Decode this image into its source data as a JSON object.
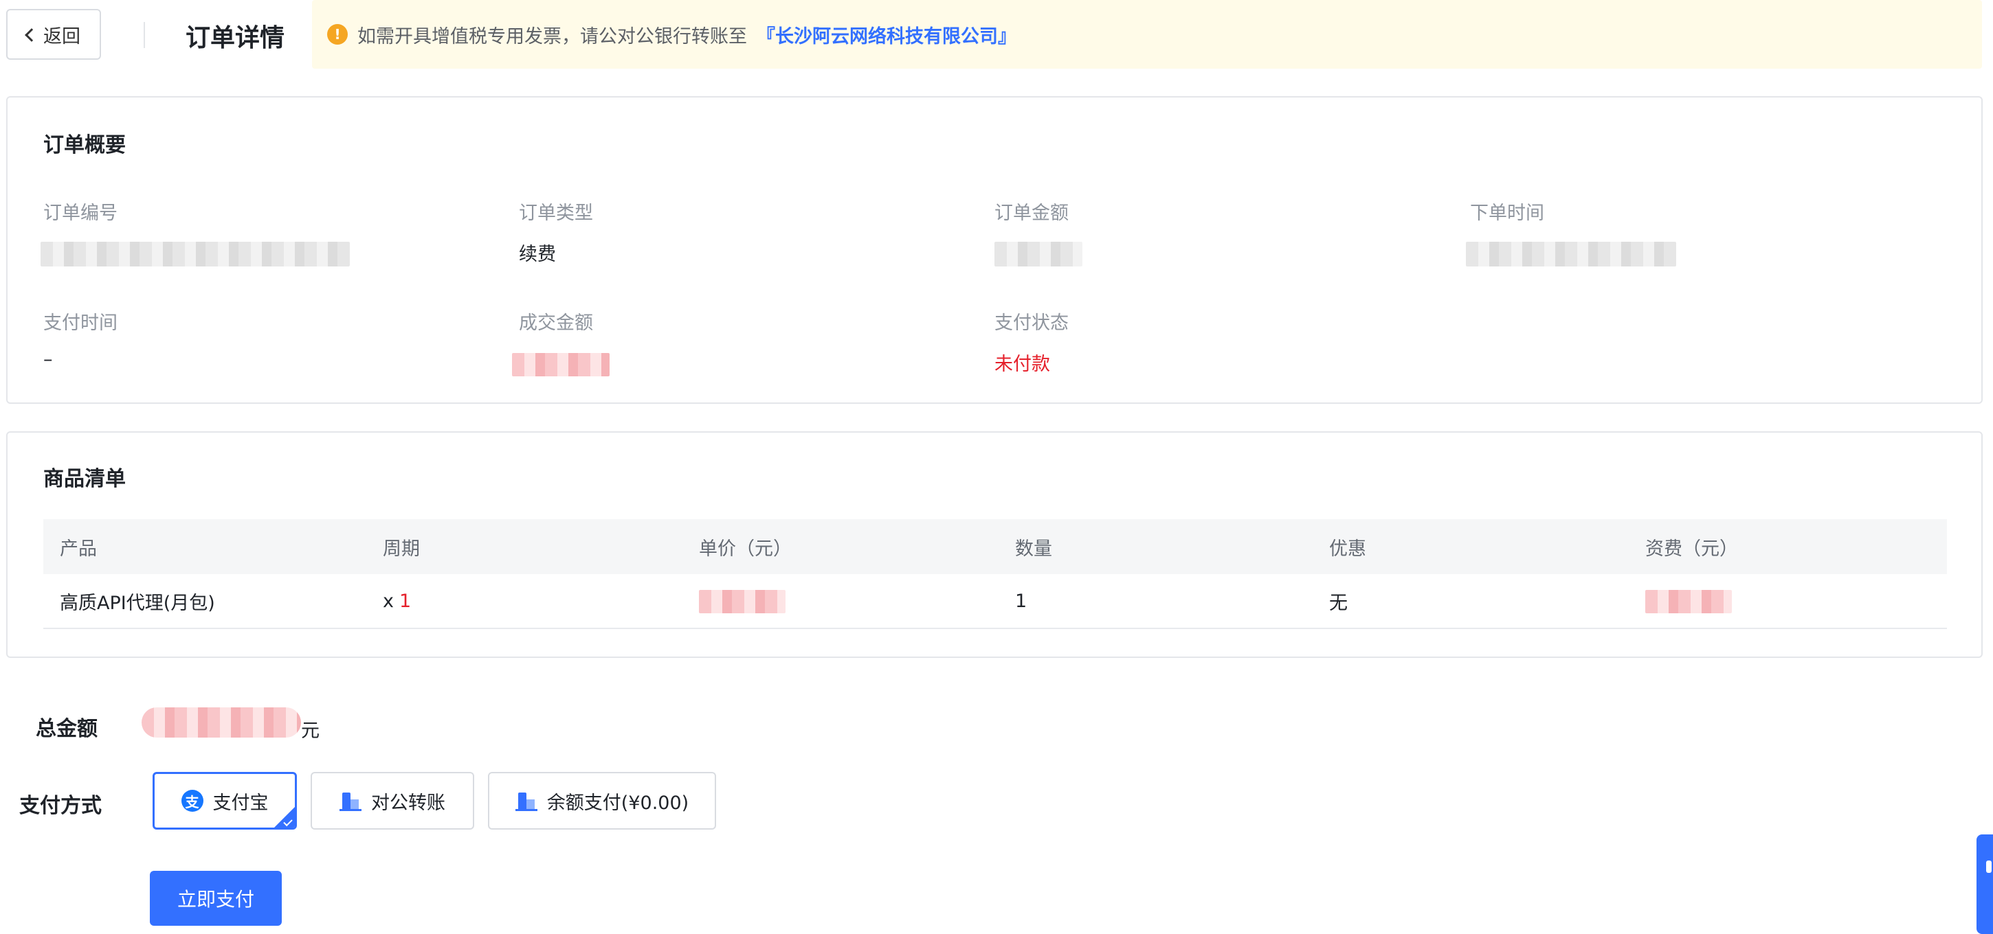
{
  "header": {
    "back_label": "返回",
    "title": "订单详情",
    "notice": {
      "text": "如需开具增值税专用发票，请公对公银行转账至",
      "company": "『长沙阿云网络科技有限公司』",
      "icon": "info-icon",
      "icon_glyph": "!"
    }
  },
  "summary": {
    "title": "订单概要",
    "fields": {
      "order_no": {
        "label": "订单编号",
        "value": ""
      },
      "order_type": {
        "label": "订单类型",
        "value": "续费"
      },
      "order_amount": {
        "label": "订单金额",
        "value": ""
      },
      "order_time": {
        "label": "下单时间",
        "value": ""
      },
      "pay_time": {
        "label": "支付时间",
        "value": "–"
      },
      "deal_amount": {
        "label": "成交金额",
        "value": ""
      },
      "pay_status": {
        "label": "支付状态",
        "value": "未付款",
        "color": "#e5202b"
      }
    }
  },
  "goods": {
    "title": "商品清单",
    "columns": [
      "产品",
      "周期",
      "单价（元）",
      "数量",
      "优惠",
      "资费（元）"
    ],
    "rows": [
      {
        "product": "高质API代理(月包)",
        "period_prefix": "x",
        "period_value": "1",
        "unit_price": "",
        "quantity": "1",
        "discount": "无",
        "fee": ""
      }
    ]
  },
  "total": {
    "label": "总金额",
    "unit": "元"
  },
  "payment": {
    "label": "支付方式",
    "options": [
      {
        "label": "支付宝",
        "icon": "alipay-icon",
        "glyph": "支",
        "selected": true
      },
      {
        "label": "对公转账",
        "icon": "bank-icon",
        "selected": false
      },
      {
        "label": "余额支付(¥0.00)",
        "icon": "bank-icon",
        "selected": false
      }
    ],
    "submit_label": "立即支付"
  },
  "colors": {
    "accent": "#3370ff",
    "danger": "#e5202b",
    "notice_bg": "#fffbe8"
  }
}
